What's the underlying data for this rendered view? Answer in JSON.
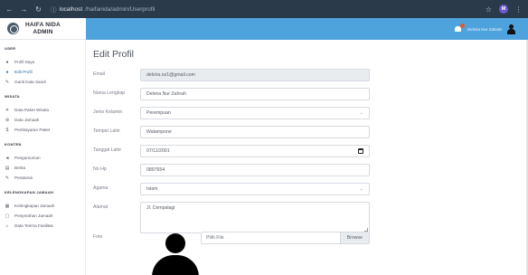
{
  "browser": {
    "url_host": "localhost",
    "url_path": "/haifanida/admin/Userprofil"
  },
  "header": {
    "brand_line1": "HAIFA NIDA",
    "brand_line2": "ADMIN",
    "user_name": "Delvira Nur Zahrah"
  },
  "sidebar": {
    "sections": [
      {
        "heading": "USER",
        "items": [
          {
            "label": "Profil Saya",
            "icon": "user-icon",
            "active": false
          },
          {
            "label": "Edit Profil",
            "icon": "user-edit-icon",
            "active": true
          },
          {
            "label": "Ganti Kata Sandi",
            "icon": "key-icon",
            "active": false
          }
        ]
      },
      {
        "heading": "WISATA",
        "items": [
          {
            "label": "Data Paket Wisata",
            "icon": "plane-icon",
            "active": false
          },
          {
            "label": "Data Jamaah",
            "icon": "users-icon",
            "active": false
          },
          {
            "label": "Pembayaran Paket",
            "icon": "payment-icon",
            "active": false
          }
        ]
      },
      {
        "heading": "KONTEN",
        "items": [
          {
            "label": "Pengumuman",
            "icon": "megaphone-icon",
            "active": false
          },
          {
            "label": "Berita",
            "icon": "news-icon",
            "active": false
          },
          {
            "label": "Peraturan",
            "icon": "pencil-icon",
            "active": false
          }
        ]
      },
      {
        "heading": "KELENGKAPAN JAMAAH",
        "items": [
          {
            "label": "Kelengkapan Jamaah",
            "icon": "folder-icon",
            "active": false
          },
          {
            "label": "Penyerahan Jamaah",
            "icon": "document-icon",
            "active": false
          },
          {
            "label": "Data Terima Fasilitas",
            "icon": "bag-icon",
            "active": false
          }
        ]
      }
    ]
  },
  "form": {
    "title": "Edit Profil",
    "email_label": "Email",
    "email_value": "delvira.nz1@gmail.com",
    "name_label": "Nama Lengkap",
    "name_value": "Delvira Nur Zahrah",
    "gender_label": "Jenis Kelamin",
    "gender_value": "Perempuan",
    "birthplace_label": "Tempat Lahir",
    "birthplace_value": "Watampone",
    "birthdate_label": "Tanggal Lahir",
    "birthdate_value": "07/11/2001",
    "phone_label": "No Hp",
    "phone_value": "0897654",
    "religion_label": "Agama",
    "religion_value": "Islam",
    "address_label": "Alamat",
    "address_value": "Jl. Cempalagi",
    "photo_label": "Foto",
    "file_placeholder": "Pilih File",
    "browse_label": "Browse"
  },
  "colors": {
    "topbar": "#4fa3dd",
    "active_link": "#2b6ea8"
  }
}
